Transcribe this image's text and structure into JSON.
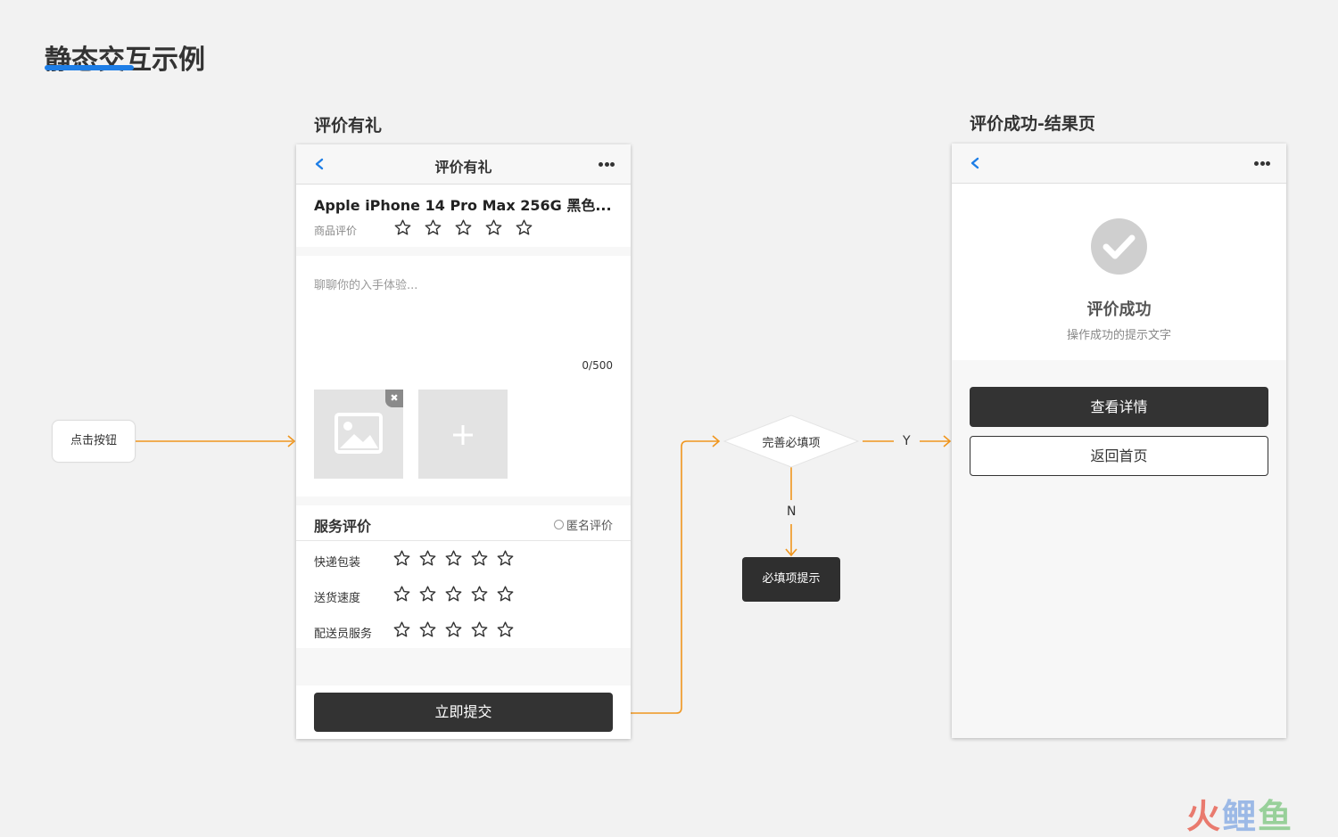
{
  "page": {
    "title": "静态交互示例"
  },
  "screen1": {
    "label": "评价有礼",
    "nav_title": "评价有礼",
    "product_name": "Apple iPhone 14 Pro Max 256G 黑色...",
    "product_rating_label": "商品评价",
    "product_rating": 0,
    "textarea_placeholder": "聊聊你的入手体验...",
    "char_counter": "0/500",
    "service_title": "服务评价",
    "anonymous_label": "匿名评价",
    "service_rows": [
      {
        "label": "快递包装",
        "rating": 0
      },
      {
        "label": "送货速度",
        "rating": 0
      },
      {
        "label": "配送员服务",
        "rating": 0
      }
    ],
    "submit_label": "立即提交"
  },
  "flow": {
    "start_label": "点击按钮",
    "decision_label": "完善必填项",
    "yes_label": "Y",
    "no_label": "N",
    "tip_label": "必填项提示",
    "line_color": "#f0961e"
  },
  "screen2": {
    "label": "评价成功-结果页",
    "success_title": "评价成功",
    "success_desc": "操作成功的提示文字",
    "primary_button": "查看详情",
    "secondary_button": "返回首页"
  },
  "watermark": {
    "part1": "火",
    "part2": "鲤",
    "part3": "鱼"
  },
  "colors": {
    "accent": "#1e7ee6",
    "flow": "#f0961e",
    "dark_button": "#333333"
  }
}
